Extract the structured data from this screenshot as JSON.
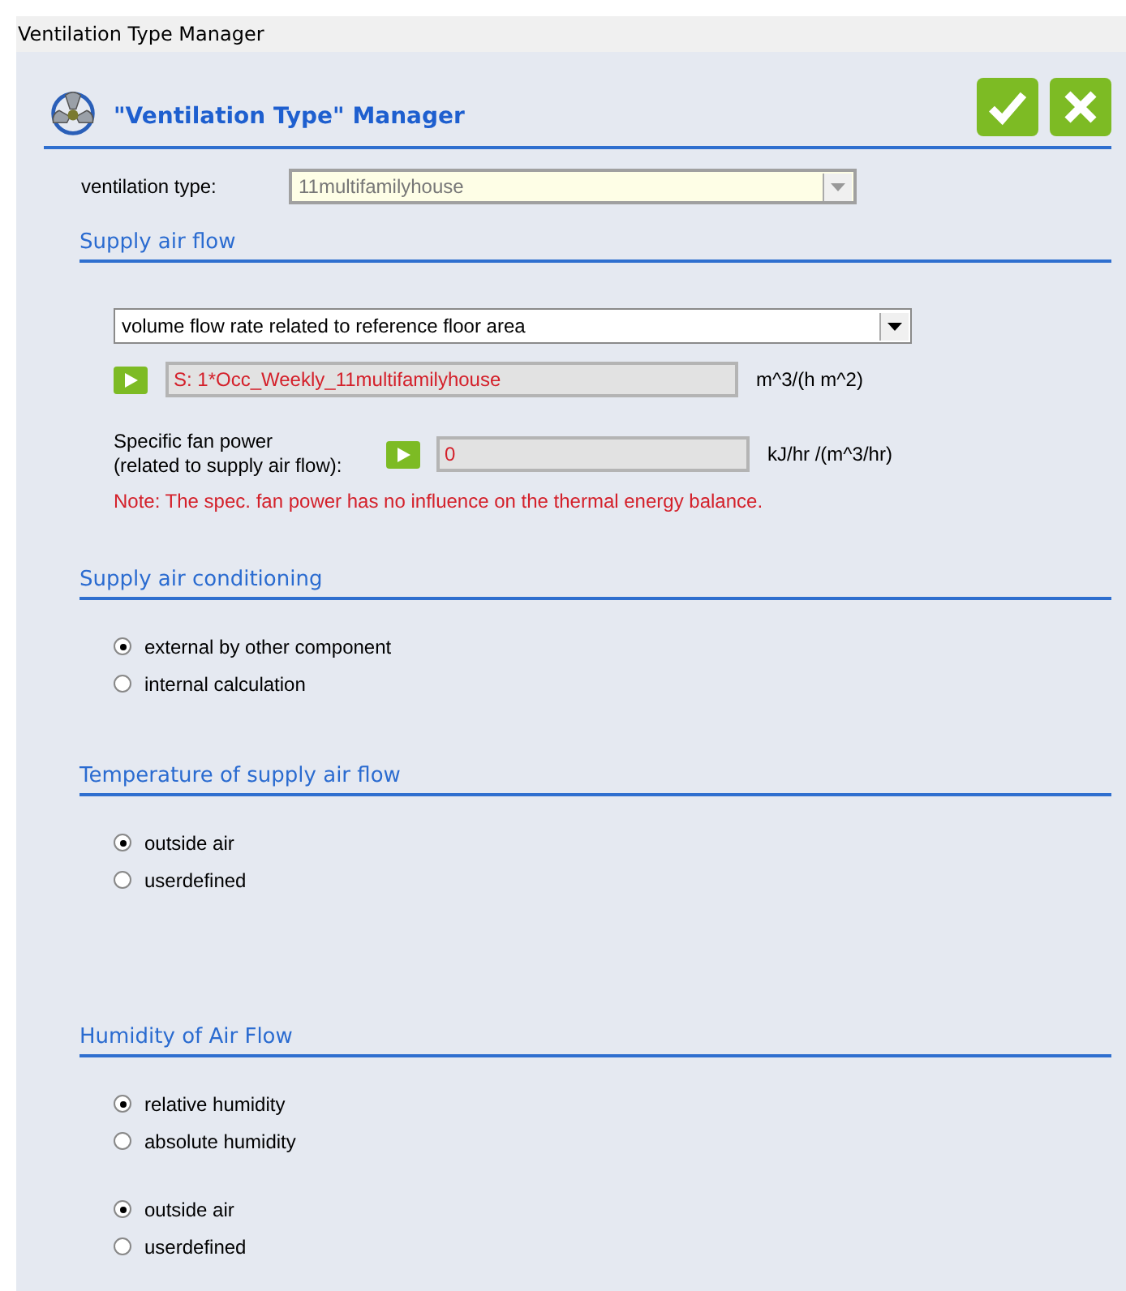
{
  "window": {
    "title": "Ventilation Type Manager"
  },
  "header": {
    "title": "\"Ventilation Type\" Manager"
  },
  "ventilation_type": {
    "label": "ventilation type:",
    "value": "11multifamilyhouse"
  },
  "sections": [
    {
      "kind": "flow",
      "title": "Supply air flow",
      "mode": "volume flow rate related to reference floor area",
      "schedule": {
        "value": "S: 1*Occ_Weekly_11multifamilyhouse",
        "unit": "m^3/(h m^2)"
      },
      "fan_power": {
        "label": "Specific fan power\n(related to supply air flow):",
        "value": "0",
        "unit": "kJ/hr /(m^3/hr)"
      },
      "note": "Note: The spec. fan power has no influence on the thermal energy balance."
    },
    {
      "kind": "radios",
      "title": "Supply air conditioning",
      "groups": [
        [
          {
            "label": "external by other component",
            "selected": true
          },
          {
            "label": "internal calculation",
            "selected": false
          }
        ]
      ]
    },
    {
      "kind": "radios",
      "title": "Temperature of supply air flow",
      "groups": [
        [
          {
            "label": "outside air",
            "selected": true
          },
          {
            "label": "userdefined",
            "selected": false
          }
        ]
      ]
    },
    {
      "kind": "radios",
      "title": "Humidity of Air Flow",
      "groups": [
        [
          {
            "label": "relative humidity",
            "selected": true
          },
          {
            "label": "absolute humidity",
            "selected": false
          }
        ],
        [
          {
            "label": "outside air",
            "selected": true
          },
          {
            "label": "userdefined",
            "selected": false
          }
        ]
      ]
    }
  ]
}
